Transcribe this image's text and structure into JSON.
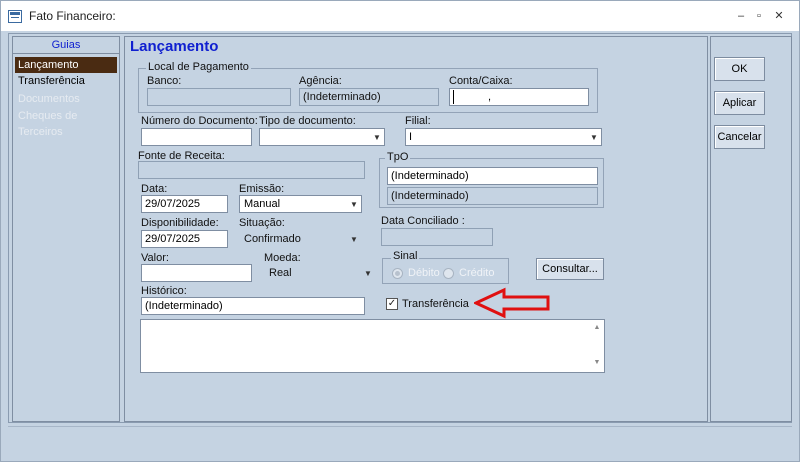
{
  "window": {
    "title": "Fato Financeiro:"
  },
  "guias": {
    "header": "Guias",
    "items": [
      {
        "label": "Lançamento"
      },
      {
        "label": "Transferência"
      },
      {
        "label": "Documentos"
      },
      {
        "label": "Cheques de Terceiros"
      }
    ]
  },
  "main": {
    "title": "Lançamento",
    "local_pagamento": {
      "group_title": "Local de Pagamento",
      "banco_label": "Banco:",
      "banco_value": "",
      "agencia_label": "Agência:",
      "agencia_value": "(Indeterminado)",
      "conta_label": "Conta/Caixa:",
      "conta_value": ","
    },
    "numero_documento_label": "Número do Documento:",
    "numero_documento_value": "",
    "tipo_documento_label": "Tipo de documento:",
    "tipo_documento_value": "",
    "filial_label": "Filial:",
    "filial_value": "I",
    "fonte_receita_label": "Fonte de Receita:",
    "fonte_receita_value": "",
    "tpo": {
      "group_title": "TpO",
      "value1": "(Indeterminado)",
      "value2": "(Indeterminado)"
    },
    "data_label": "Data:",
    "data_value": "29/07/2025",
    "emissao_label": "Emissão:",
    "emissao_value": "Manual",
    "disponibilidade_label": "Disponibilidade:",
    "disponibilidade_value": "29/07/2025",
    "situacao_label": "Situação:",
    "situacao_value": "Confirmado",
    "data_conciliado_label": "Data Conciliado :",
    "data_conciliado_value": "",
    "valor_label": "Valor:",
    "valor_value": "",
    "moeda_label": "Moeda:",
    "moeda_value": "Real",
    "sinal": {
      "group_title": "Sinal",
      "debito_label": "Débito",
      "credito_label": "Crédito"
    },
    "consultar_label": "Consultar...",
    "historico_label": "Histórico:",
    "historico_value": "(Indeterminado)",
    "transferencia_label": "Transferência",
    "transferencia_checked": "✓",
    "memo_value": ""
  },
  "actions": {
    "ok": "OK",
    "aplicar": "Aplicar",
    "cancelar": "Cancelar"
  },
  "colors": {
    "background": "#c5d3e2",
    "active_tab": "#4a2b12",
    "title_blue": "#1020d0",
    "annotation_arrow": "#e01010"
  }
}
